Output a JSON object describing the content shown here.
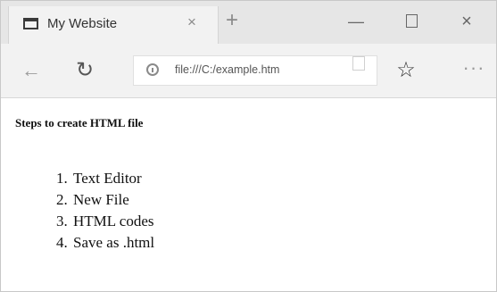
{
  "browser": {
    "tab": {
      "title": "My Website",
      "close_glyph": "×",
      "icon": "page-icon"
    },
    "new_tab_glyph": "+",
    "window_controls": {
      "minimize_glyph": "—",
      "close_glyph": "×"
    },
    "nav": {
      "back_glyph": "←",
      "refresh_glyph": "↻",
      "favorites_glyph": "☆",
      "more_glyph": "···"
    },
    "address": {
      "url": "file:///C:/example.htm",
      "icon": "info-icon"
    }
  },
  "page": {
    "heading": "Steps to create HTML file",
    "steps": [
      "Text Editor",
      "New File",
      "HTML codes",
      "Save as .html"
    ]
  }
}
